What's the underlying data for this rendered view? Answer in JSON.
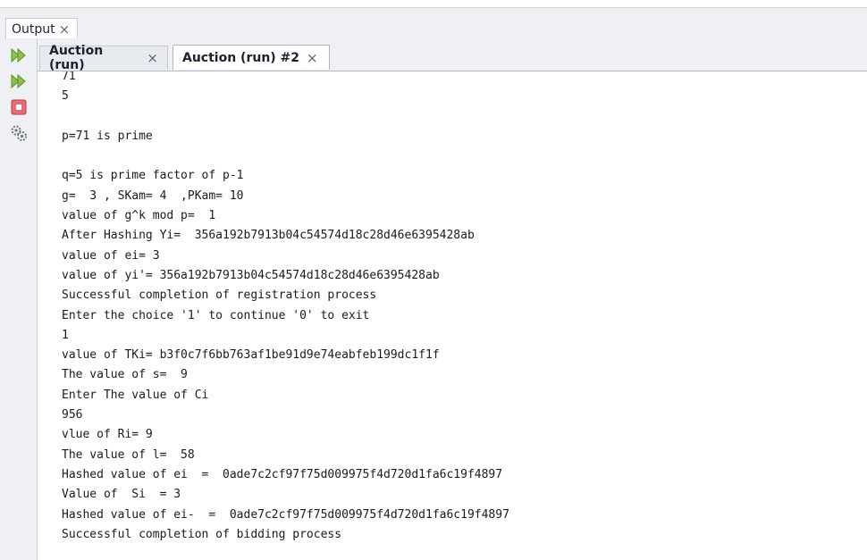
{
  "output_panel": {
    "tab_label": "Output",
    "close_glyph": "×"
  },
  "toolbar": {
    "buttons": [
      {
        "name": "rerun",
        "icon": "double-play-icon",
        "color": "#7fb33b"
      },
      {
        "name": "rerun-with-params",
        "icon": "double-play-icon",
        "color": "#7fb33b"
      },
      {
        "name": "stop",
        "icon": "stop-icon",
        "color": "#e0485c"
      },
      {
        "name": "settings",
        "icon": "gear-tools-icon",
        "color": "#6c7680"
      }
    ]
  },
  "tabs": [
    {
      "label": "Auction (run)",
      "close": "×",
      "active": false
    },
    {
      "label": "Auction (run) #2",
      "close": "×",
      "active": true
    }
  ],
  "console": {
    "lines": [
      "71",
      "5",
      "",
      "p=71 is prime",
      "",
      "q=5 is prime factor of p-1",
      "g=  3 , SKam= 4  ,PKam= 10",
      "value of g^k mod p=  1",
      "After Hashing Yi=  356a192b7913b04c54574d18c28d46e6395428ab",
      "value of ei= 3",
      "value of yi'= 356a192b7913b04c54574d18c28d46e6395428ab",
      "Successful completion of registration process",
      "Enter the choice '1' to continue '0' to exit",
      "1",
      "value of TKi= b3f0c7f6bb763af1be91d9e74eabfeb199dc1f1f",
      "The value of s=  9",
      "Enter The value of Ci",
      "956",
      "vlue of Ri= 9",
      "The value of l=  58",
      "Hashed value of ei  =  0ade7c2cf97f75d009975f4d720d1fa6c19f4897",
      "Value of  Si  = 3",
      "Hashed value of ei-  =  0ade7c2cf97f75d009975f4d720d1fa6c19f4897",
      "Successful completion of bidding process"
    ]
  },
  "colors": {
    "toolbar_bg": "#eef0f3",
    "play_green": "#7fb33b",
    "stop_red": "#e0485c"
  }
}
